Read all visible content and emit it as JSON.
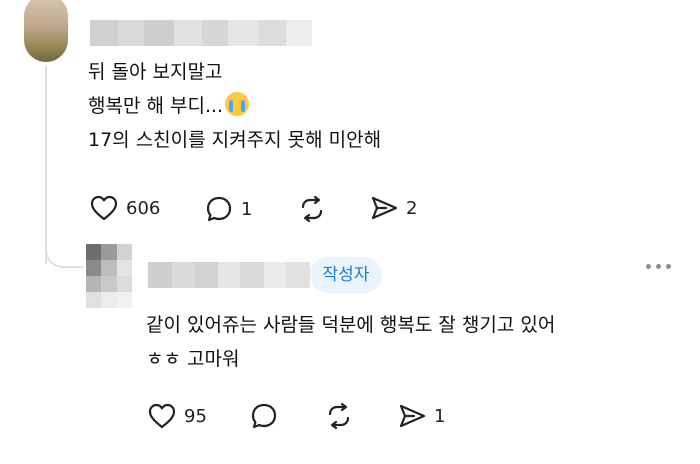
{
  "comment": {
    "lines": [
      "뒤 돌아 보지말고",
      "행복만 해 부디...",
      "17의 스친이를 지켜주지 못해 미안해"
    ],
    "emoji": "crying-face",
    "actions": {
      "likes": "606",
      "replies": "1",
      "reposts": "",
      "shares": "2"
    }
  },
  "reply": {
    "author_badge": "작성자",
    "lines": [
      "같이 있어쥬는 사람들 덕분에 행복도 잘 챙기고 있어",
      "ㅎㅎ 고마워"
    ],
    "actions": {
      "likes": "95",
      "replies": "",
      "reposts": "",
      "shares": "1"
    }
  },
  "colors": {
    "badge_bg": "#e9f4ff",
    "badge_text": "#1c7ad8",
    "text": "#111111",
    "icon": "#222222"
  }
}
